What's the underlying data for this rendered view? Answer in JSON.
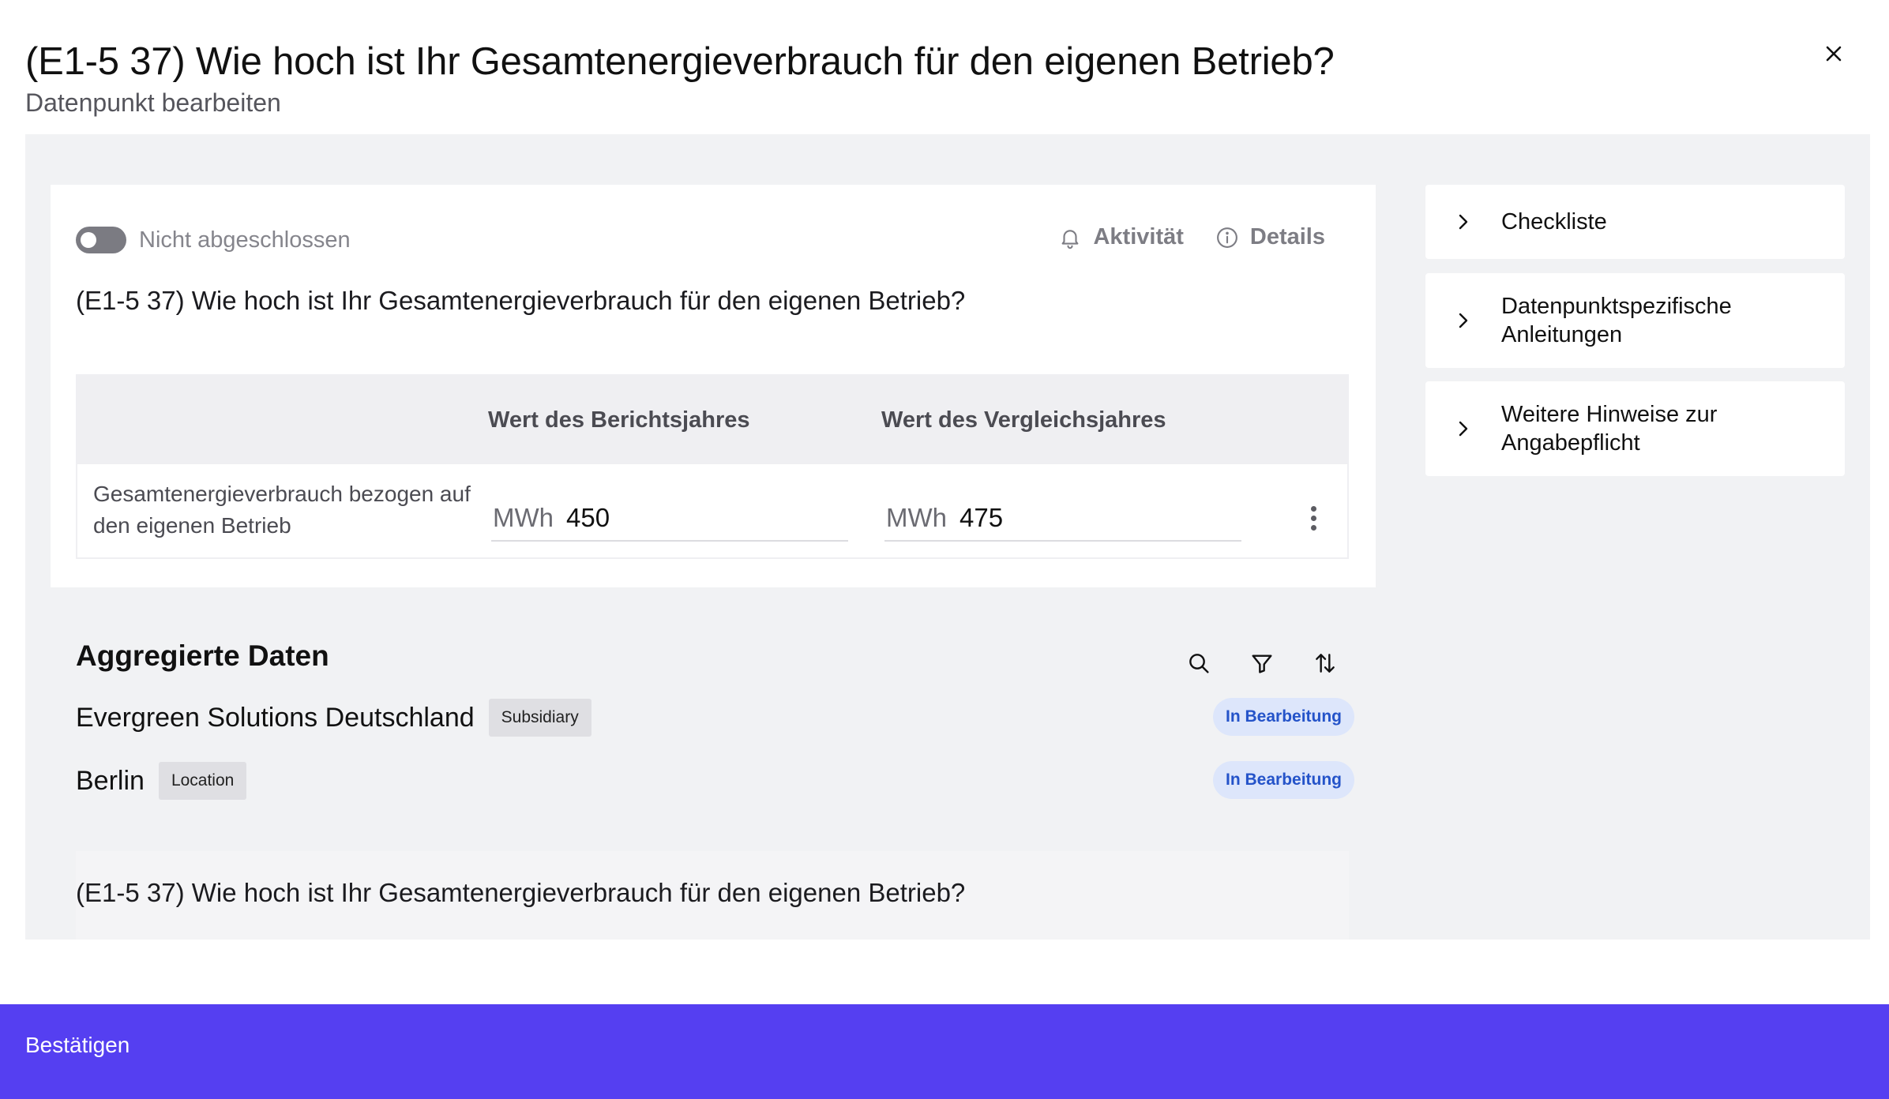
{
  "header": {
    "title": "(E1-5 37) Wie hoch ist Ihr Gesamtenergieverbrauch für den eigenen Betrieb?",
    "subtitle": "Datenpunkt bearbeiten",
    "close_icon": "close-icon"
  },
  "card": {
    "status": {
      "label": "Nicht abgeschlossen",
      "completed": false
    },
    "actions": {
      "activity_label": "Aktivität",
      "activity_icon": "bell-icon",
      "details_label": "Details",
      "details_icon": "info-icon"
    },
    "question": "(E1-5 37) Wie hoch ist Ihr Gesamtenergieverbrauch für den eigenen Betrieb?",
    "table": {
      "headers": [
        "",
        "Wert des Berichtsjahres",
        "Wert des Vergleichsjahres"
      ],
      "rows": [
        {
          "label": "Gesamtenergieverbrauch bezogen auf den eigenen Betrieb",
          "reporting": {
            "unit": "MWh",
            "value": "450"
          },
          "comparison": {
            "unit": "MWh",
            "value": "475"
          },
          "menu_icon": "more-vertical-icon"
        }
      ]
    }
  },
  "aggregated": {
    "title": "Aggregierte Daten",
    "tools": [
      "search-icon",
      "filter-icon",
      "sort-icon"
    ],
    "items": [
      {
        "name": "Evergreen Solutions Deutschland",
        "tag": "Subsidiary",
        "status": "In Bearbeitung"
      },
      {
        "name": "Berlin",
        "tag": "Location",
        "status": "In Bearbeitung"
      }
    ],
    "sub_question": "(E1-5 37) Wie hoch ist Ihr Gesamtenergieverbrauch für den eigenen Betrieb?"
  },
  "side_panels": [
    {
      "label": "Checkliste",
      "icon": "chevron-right-icon"
    },
    {
      "label": "Datenpunktspezifische Anleitungen",
      "icon": "chevron-right-icon"
    },
    {
      "label": "Weitere Hinweise zur Angabepflicht",
      "icon": "chevron-right-icon"
    }
  ],
  "footer": {
    "confirm_label": "Bestätigen"
  },
  "colors": {
    "accent": "#553ff1",
    "badge_bg": "#dde6fb",
    "badge_text": "#2453c9",
    "panel_bg": "#f1f2f4"
  }
}
